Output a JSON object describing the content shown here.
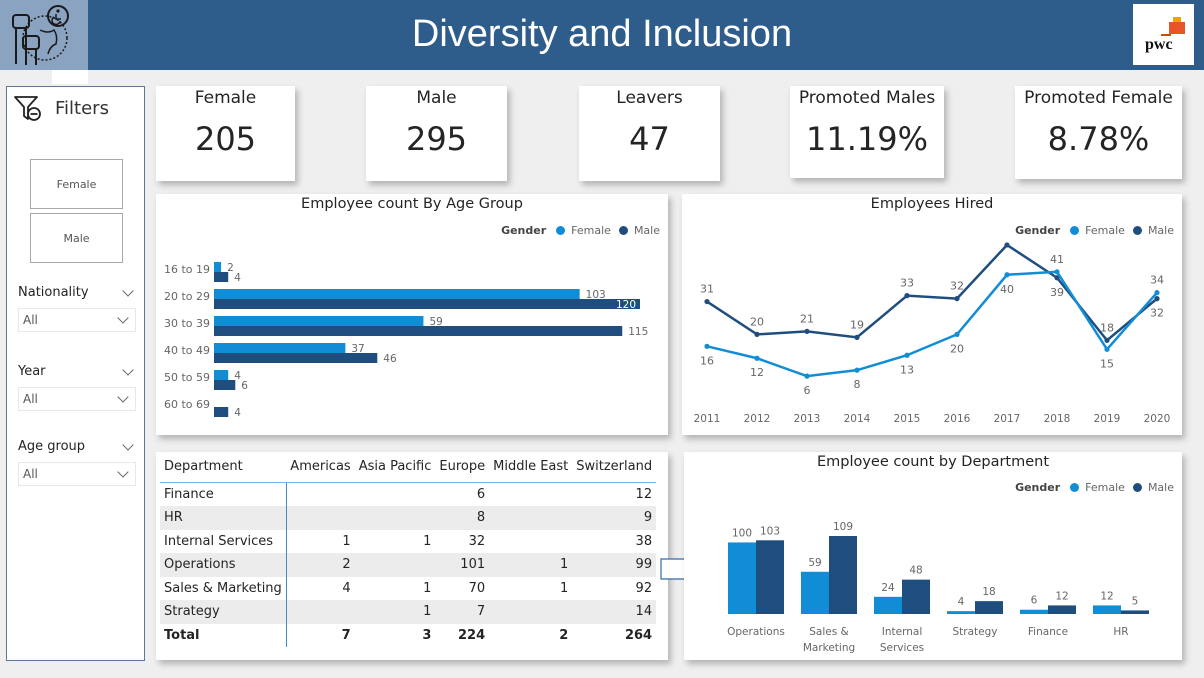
{
  "header": {
    "title": "Diversity and Inclusion",
    "logo_icon": "diversity-fists-globe-icon",
    "brand_logo_text": "pwc"
  },
  "colors": {
    "header_bg": "#2f5d8b",
    "female": "#118dd6",
    "male": "#1f4e7e"
  },
  "filters": {
    "title": "Filters",
    "icon": "filter-clear-icon",
    "gender_buttons": [
      "Female",
      "Male"
    ],
    "slicers": [
      {
        "label": "Nationality",
        "value": "All"
      },
      {
        "label": "Year",
        "value": "All"
      },
      {
        "label": "Age group",
        "value": "All"
      }
    ]
  },
  "cards": [
    {
      "title": "Female",
      "value": "205"
    },
    {
      "title": "Male",
      "value": "295"
    },
    {
      "title": "Leavers",
      "value": "47"
    },
    {
      "title": "Promoted Males",
      "value": "11.19%"
    },
    {
      "title": "Promoted Female",
      "value": "8.78%"
    }
  ],
  "chart_data": [
    {
      "type": "bar",
      "orientation": "horizontal",
      "title": "Employee count By Age Group",
      "legend_title": "Gender",
      "legend_position": "top-right",
      "categories": [
        "16 to 19",
        "20 to 29",
        "30 to 39",
        "40 to 49",
        "50 to 59",
        "60 to 69"
      ],
      "series": [
        {
          "name": "Female",
          "values": [
            2,
            103,
            59,
            37,
            4,
            null
          ]
        },
        {
          "name": "Male",
          "values": [
            4,
            120,
            115,
            46,
            6,
            4
          ]
        }
      ],
      "xlim": [
        0,
        120
      ]
    },
    {
      "type": "line",
      "title": "Employees Hired",
      "legend_title": "Gender",
      "legend_position": "top-right",
      "x": [
        "2011",
        "2012",
        "2013",
        "2014",
        "2015",
        "2016",
        "2017",
        "2018",
        "2019",
        "2020"
      ],
      "series": [
        {
          "name": "Female",
          "values": [
            16,
            12,
            6,
            8,
            13,
            20,
            40,
            41,
            15,
            34
          ],
          "labels": [
            "16",
            "12",
            "6",
            "8",
            "13",
            "20",
            "40",
            "41",
            "15",
            "34"
          ]
        },
        {
          "name": "Male",
          "values": [
            31,
            20,
            21,
            19,
            33,
            32,
            50,
            39,
            18,
            32
          ],
          "labels": [
            "31",
            "20",
            "21",
            "19",
            "33",
            "32",
            "",
            "39",
            "18",
            "32"
          ]
        }
      ],
      "ylim": [
        0,
        52
      ]
    },
    {
      "type": "bar",
      "orientation": "vertical",
      "title": "Employee count by Department",
      "legend_title": "Gender",
      "legend_position": "top-right",
      "categories": [
        "Operations",
        "Sales & Marketing",
        "Internal Services",
        "Strategy",
        "Finance",
        "HR"
      ],
      "category_lines": [
        [
          "Operations"
        ],
        [
          "Sales &",
          "Marketing"
        ],
        [
          "Internal",
          "Services"
        ],
        [
          "Strategy"
        ],
        [
          "Finance"
        ],
        [
          "HR"
        ]
      ],
      "series": [
        {
          "name": "Female",
          "values": [
            100,
            59,
            24,
            4,
            6,
            12
          ]
        },
        {
          "name": "Male",
          "values": [
            103,
            109,
            48,
            18,
            12,
            5
          ]
        }
      ],
      "ylim": [
        0,
        109
      ]
    }
  ],
  "matrix": {
    "columns": [
      "Department",
      "Americas",
      "Asia Pacific",
      "Europe",
      "Middle East",
      "Switzerland"
    ],
    "rows": [
      [
        "Finance",
        "",
        "",
        "6",
        "",
        "12"
      ],
      [
        "HR",
        "",
        "",
        "8",
        "",
        "9"
      ],
      [
        "Internal Services",
        "1",
        "1",
        "32",
        "",
        "38"
      ],
      [
        "Operations",
        "2",
        "",
        "101",
        "1",
        "99"
      ],
      [
        "Sales & Marketing",
        "4",
        "1",
        "70",
        "1",
        "92"
      ],
      [
        "Strategy",
        "",
        "1",
        "7",
        "",
        "14"
      ]
    ],
    "total": [
      "Total",
      "7",
      "3",
      "224",
      "2",
      "264"
    ]
  }
}
